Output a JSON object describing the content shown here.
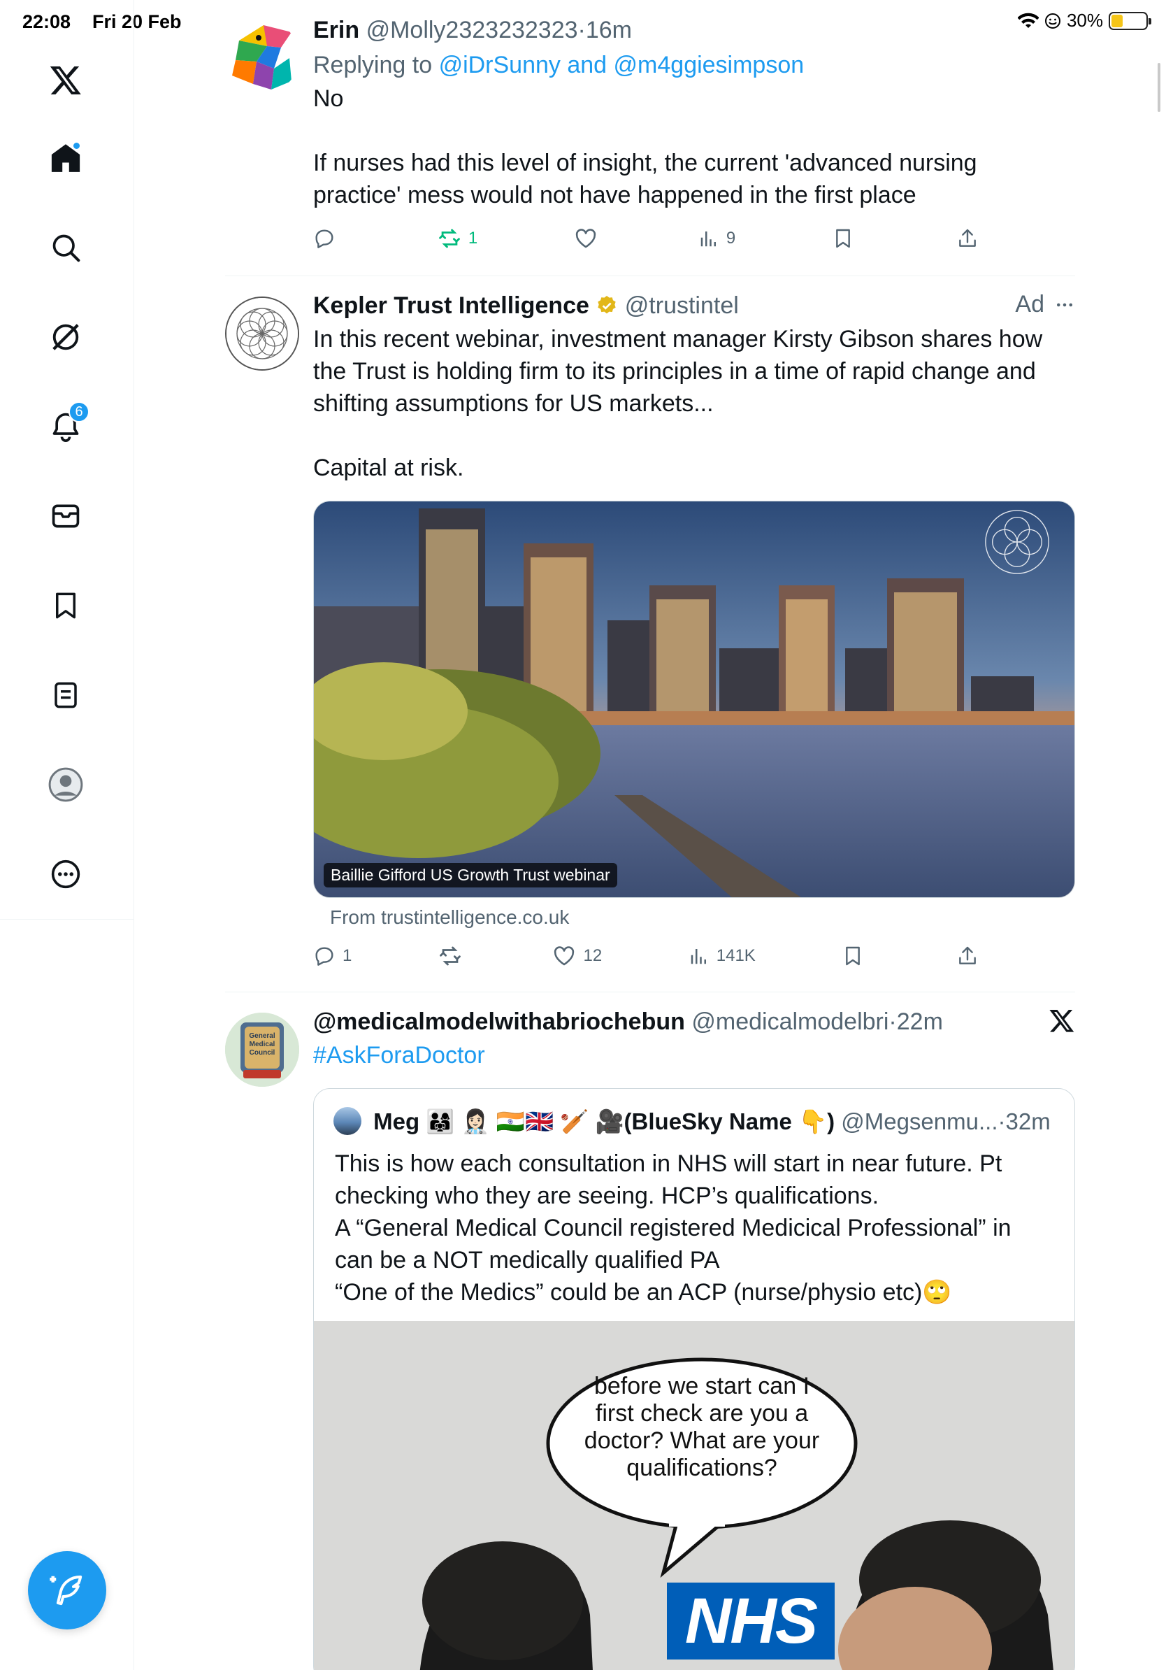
{
  "status_bar": {
    "time": "22:08",
    "date": "Fri 20 Feb",
    "battery": "30%"
  },
  "sidebar": {
    "notifications_count": "6",
    "items": [
      "Home",
      "Search",
      "Grok",
      "Notifications",
      "Messages",
      "Bookmarks",
      "Lists",
      "Profile",
      "More"
    ]
  },
  "tweets": [
    {
      "name": "Erin",
      "handle": "@Molly2323232323",
      "dot": "·",
      "time": "16m",
      "replying_prefix": "Replying to",
      "replying_to": "@iDrSunny and @m4ggiesimpson",
      "text_1": "No",
      "text_2": "If nurses had this level of insight, the current 'advanced nursing practice' mess would not have happened in the first place",
      "reposts": "1",
      "views": "9"
    },
    {
      "name": "Kepler Trust Intelligence",
      "handle": "@trustintel",
      "ad_label": "Ad",
      "text_1": "In this recent webinar, investment manager Kirsty Gibson shares how the Trust is holding firm to its principles in a time of rapid change and shifting assumptions for US markets...",
      "text_2": "Capital at risk.",
      "media_caption": "Baillie Gifford US Growth Trust webinar",
      "from_line": "From trustintelligence.co.uk",
      "replies": "1",
      "likes": "12",
      "views": "141K"
    },
    {
      "name": "@medicalmodelwithabriochebun",
      "handle": "@medicalmodelbri",
      "dot": "·",
      "time": "22m",
      "hashtag": "#AskForaDoctor",
      "quote": {
        "name": "Meg 👨‍👩‍👧 👩🏻‍⚕️ 🇮🇳🇬🇧 🏏 🎥(BlueSky Name 👇)",
        "handle": "@Megsenmu...",
        "dot": "·",
        "time": "32m",
        "text_1": "This is how each consultation in NHS will start in near future. Pt checking who they are seeing. HCP’s qualifications.",
        "text_2": "A “General Medical Council registered Medicical Professional” in can be a NOT medically qualified PA",
        "text_3": "“One of the Medics” could be an ACP (nurse/physio etc)🙄",
        "bubble_text": "before we start can I first check are you a doctor? What are your qualifications?",
        "sign_text": "NHS"
      },
      "avatar_text": "General Medical Council"
    }
  ]
}
